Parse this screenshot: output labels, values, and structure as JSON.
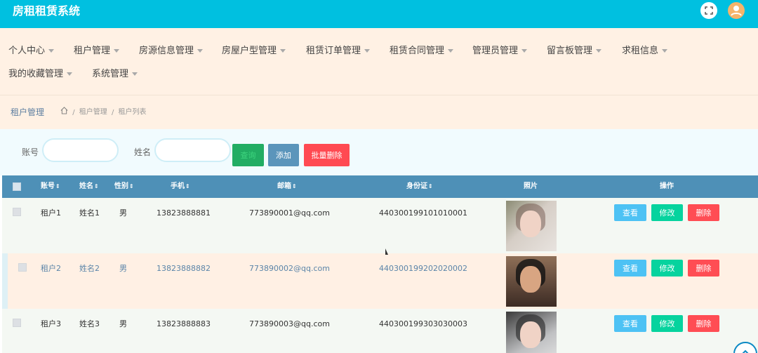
{
  "app": {
    "title": "房租租赁系统"
  },
  "header": {
    "fullscreen_icon": "fullscreen-icon",
    "avatar_icon": "user-avatar-icon"
  },
  "menu": {
    "items": [
      {
        "label": "个人中心"
      },
      {
        "label": "租户管理"
      },
      {
        "label": "房源信息管理"
      },
      {
        "label": "房屋户型管理"
      },
      {
        "label": "租赁订单管理"
      },
      {
        "label": "租赁合同管理"
      },
      {
        "label": "管理员管理"
      },
      {
        "label": "留言板管理"
      },
      {
        "label": "求租信息"
      },
      {
        "label": "我的收藏管理"
      },
      {
        "label": "系统管理"
      }
    ]
  },
  "breadcrumb": {
    "title": "租户管理",
    "home_icon": "home-icon",
    "separator": "/",
    "path": [
      "租户管理",
      "租户列表"
    ]
  },
  "search": {
    "account_label": "账号",
    "account_value": "",
    "name_label": "姓名",
    "name_value": ""
  },
  "buttons": {
    "query": "查询",
    "add": "添加",
    "batch_delete": "批量删除"
  },
  "table": {
    "headers": [
      {
        "label": "账号",
        "sort": "⇕"
      },
      {
        "label": "姓名",
        "sort": "⇕"
      },
      {
        "label": "性别",
        "sort": "⇕"
      },
      {
        "label": "手机",
        "sort": "⇕"
      },
      {
        "label": "邮箱",
        "sort": "⇕"
      },
      {
        "label": "身份证",
        "sort": "⇕"
      },
      {
        "label": "照片",
        "sort": ""
      },
      {
        "label": "操作",
        "sort": ""
      }
    ],
    "rows": [
      {
        "account": "租户1",
        "name": "姓名1",
        "gender": "男",
        "phone": "13823888881",
        "email": "773890001@qq.com",
        "id_card": "440300199101010001"
      },
      {
        "account": "租户2",
        "name": "姓名2",
        "gender": "男",
        "phone": "13823888882",
        "email": "773890002@qq.com",
        "id_card": "440300199202020002"
      },
      {
        "account": "租户3",
        "name": "姓名3",
        "gender": "男",
        "phone": "13823888883",
        "email": "773890003@qq.com",
        "id_card": "440300199303030003"
      }
    ],
    "actions": {
      "view": "查看",
      "edit": "修改",
      "delete": "删除"
    }
  },
  "colors": {
    "topbar": "#00c0e0",
    "table_header": "#4e90b7",
    "query_button": "#22ad63",
    "add_button": "#5b95bb",
    "delete_button": "#ff4d54",
    "view_button": "#4dc2f4",
    "edit_button": "#06d39e"
  }
}
